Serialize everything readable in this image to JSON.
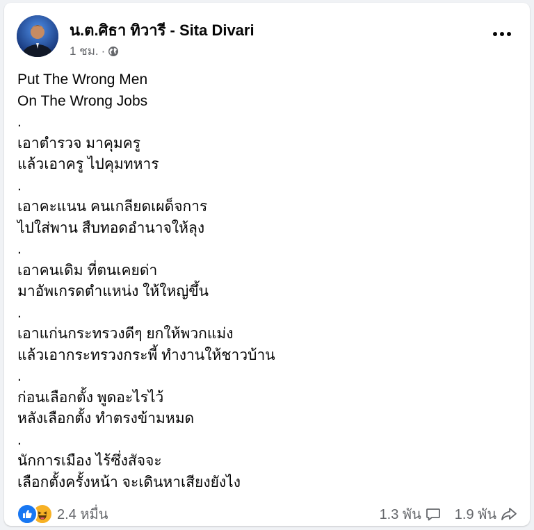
{
  "post": {
    "author_name": "น.ต.ศิธา ทิวารี - Sita Divari",
    "time": "1 ชม.",
    "separator": "·",
    "audience_icon": "globe-icon",
    "more_icon": "more-dots-icon",
    "lines": [
      "Put The Wrong Men",
      "On The Wrong Jobs",
      ".",
      "เอาตำรวจ มาคุมครู",
      "แล้วเอาครู ไปคุมทหาร",
      ".",
      "เอาคะแนน คนเกลียดเผด็จการ",
      "ไปใส่พาน สืบทอดอำนาจให้ลุง",
      ".",
      "เอาคนเดิม ที่ตนเคยด่า",
      "มาอัพเกรดตำแหน่ง ให้ใหญ่ขึ้น",
      ".",
      "เอาแก่นกระทรวงดีๆ ยกให้พวกแม่ง",
      "แล้วเอากระทรวงกระพี้ ทำงานให้ชาวบ้าน",
      ".",
      "ก่อนเลือกตั้ง พูดอะไรไว้",
      "หลังเลือกตั้ง ทำตรงข้ามหมด",
      ".",
      "นักการเมือง ไร้ซึ่งสัจจะ",
      "เลือกตั้งครั้งหน้า จะเดินหาเสียงยังไง"
    ]
  },
  "footer": {
    "reaction_icons": [
      "like-icon",
      "haha-icon"
    ],
    "reaction_count": "2.4 หมื่น",
    "comment_count": "1.3 พัน",
    "comment_icon": "comment-icon",
    "share_count": "1.9 พัน",
    "share_icon": "share-icon"
  },
  "colors": {
    "background": "#f0f2f5",
    "card": "#ffffff",
    "primary_text": "#050505",
    "secondary_text": "#65676b",
    "like_blue": "#1877f2",
    "haha_yellow": "#f7b125"
  }
}
